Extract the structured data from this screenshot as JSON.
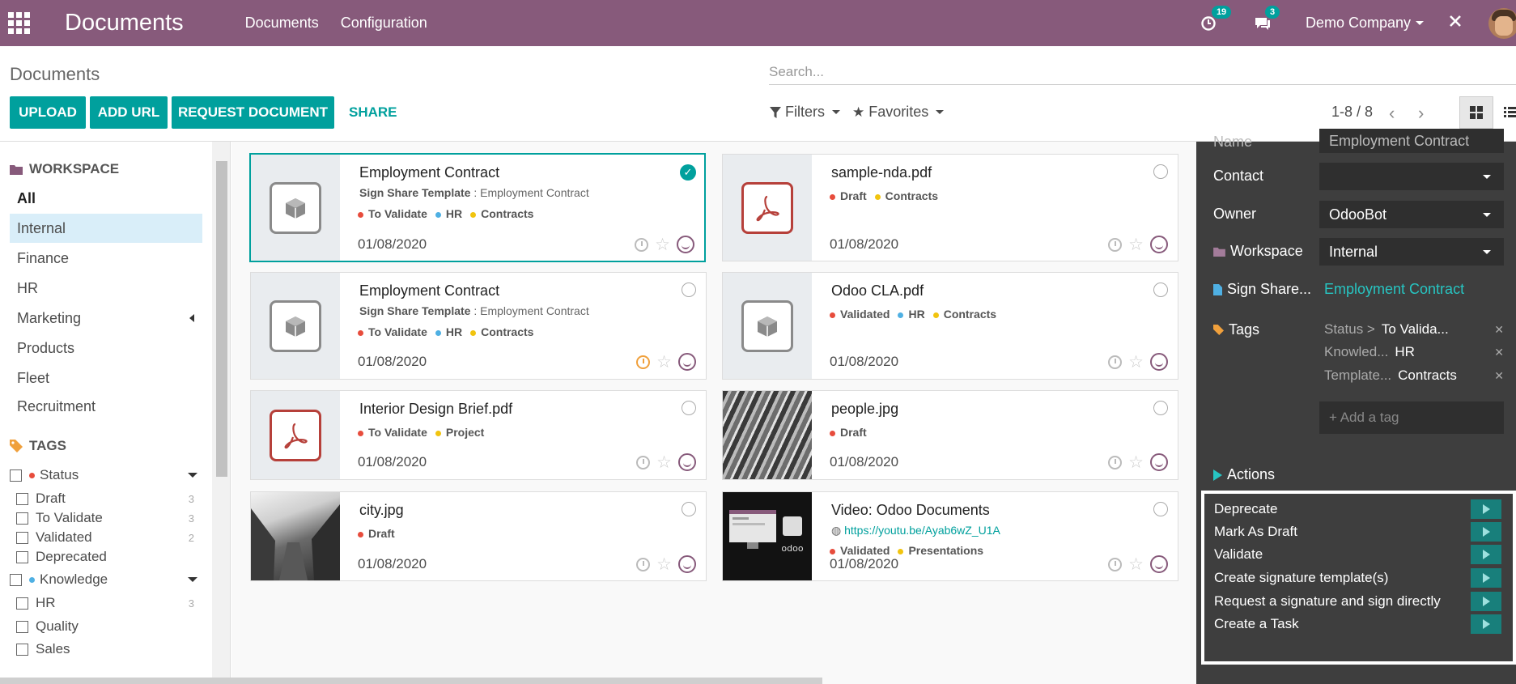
{
  "navbar": {
    "app_title": "Documents",
    "menu": [
      "Documents",
      "Configuration"
    ],
    "activity_count": "19",
    "message_count": "3",
    "company": "Demo Company"
  },
  "control": {
    "breadcrumb": "Documents",
    "search_placeholder": "Search...",
    "buttons": {
      "upload": "UPLOAD",
      "add_url": "ADD URL",
      "request": "REQUEST DOCUMENT",
      "share": "SHARE"
    },
    "filters": "Filters",
    "favorites": "Favorites",
    "pager": "1-8 / 8"
  },
  "sidebar": {
    "workspace_title": "WORKSPACE",
    "workspaces": [
      "All",
      "Internal",
      "Finance",
      "HR",
      "Marketing",
      "Products",
      "Fleet",
      "Recruitment"
    ],
    "active_workspace": "Internal",
    "tags_title": "TAGS",
    "status_group": "Status",
    "status_tags": [
      {
        "label": "Draft",
        "count": "3"
      },
      {
        "label": "To Validate",
        "count": "3"
      },
      {
        "label": "Validated",
        "count": "2"
      },
      {
        "label": "Deprecated",
        "count": ""
      }
    ],
    "knowledge_group": "Knowledge",
    "knowledge_tags": [
      {
        "label": "HR",
        "count": "3"
      },
      {
        "label": "Quality",
        "count": ""
      },
      {
        "label": "Sales",
        "count": ""
      }
    ]
  },
  "cards": [
    {
      "title": "Employment Contract",
      "sub_label": "Sign Share Template",
      "sub_value": ": Employment Contract",
      "tags": [
        "To Validate",
        "HR",
        "Contracts"
      ],
      "date": "01/08/2020"
    },
    {
      "title": "sample-nda.pdf",
      "tags": [
        "Draft",
        "Contracts"
      ],
      "date": "01/08/2020"
    },
    {
      "title": "Employment Contract",
      "sub_label": "Sign Share Template",
      "sub_value": ": Employment Contract",
      "tags": [
        "To Validate",
        "HR",
        "Contracts"
      ],
      "date": "01/08/2020"
    },
    {
      "title": "Odoo CLA.pdf",
      "tags": [
        "Validated",
        "HR",
        "Contracts"
      ],
      "date": "01/08/2020"
    },
    {
      "title": "Interior Design Brief.pdf",
      "tags": [
        "To Validate",
        "Project"
      ],
      "date": "01/08/2020"
    },
    {
      "title": "people.jpg",
      "tags": [
        "Draft"
      ],
      "date": "01/08/2020"
    },
    {
      "title": "city.jpg",
      "tags": [
        "Draft"
      ],
      "date": "01/08/2020"
    },
    {
      "title": "Video: Odoo Documents",
      "url": "https://youtu.be/Ayab6wZ_U1A",
      "tags": [
        "Validated",
        "Presentations"
      ],
      "date": "01/08/2020"
    }
  ],
  "inspector": {
    "name_label": "Name",
    "name_value": "Employment Contract",
    "contact_label": "Contact",
    "contact_value": "",
    "owner_label": "Owner",
    "owner_value": "OdooBot",
    "workspace_label": "Workspace",
    "workspace_value": "Internal",
    "sign_label": "Sign Share...",
    "sign_value": "Employment Contract",
    "tags_label": "Tags",
    "tags": [
      {
        "category": "Status >",
        "value": "To Valida..."
      },
      {
        "category": "Knowled...",
        "value": "HR"
      },
      {
        "category": "Template...",
        "value": "Contracts"
      }
    ],
    "add_tag_placeholder": "+ Add a tag",
    "actions_label": "Actions",
    "actions": [
      "Deprecate",
      "Mark As Draft",
      "Validate",
      "Create signature template(s)",
      "Request a signature and sign directly",
      "Create a Task"
    ]
  },
  "colors": {
    "brand": "#875a7b",
    "accent": "#00a09d",
    "status_dot": "#e74c3c",
    "hr_dot": "#4fb0e3",
    "contracts_dot": "#f1c40f"
  }
}
